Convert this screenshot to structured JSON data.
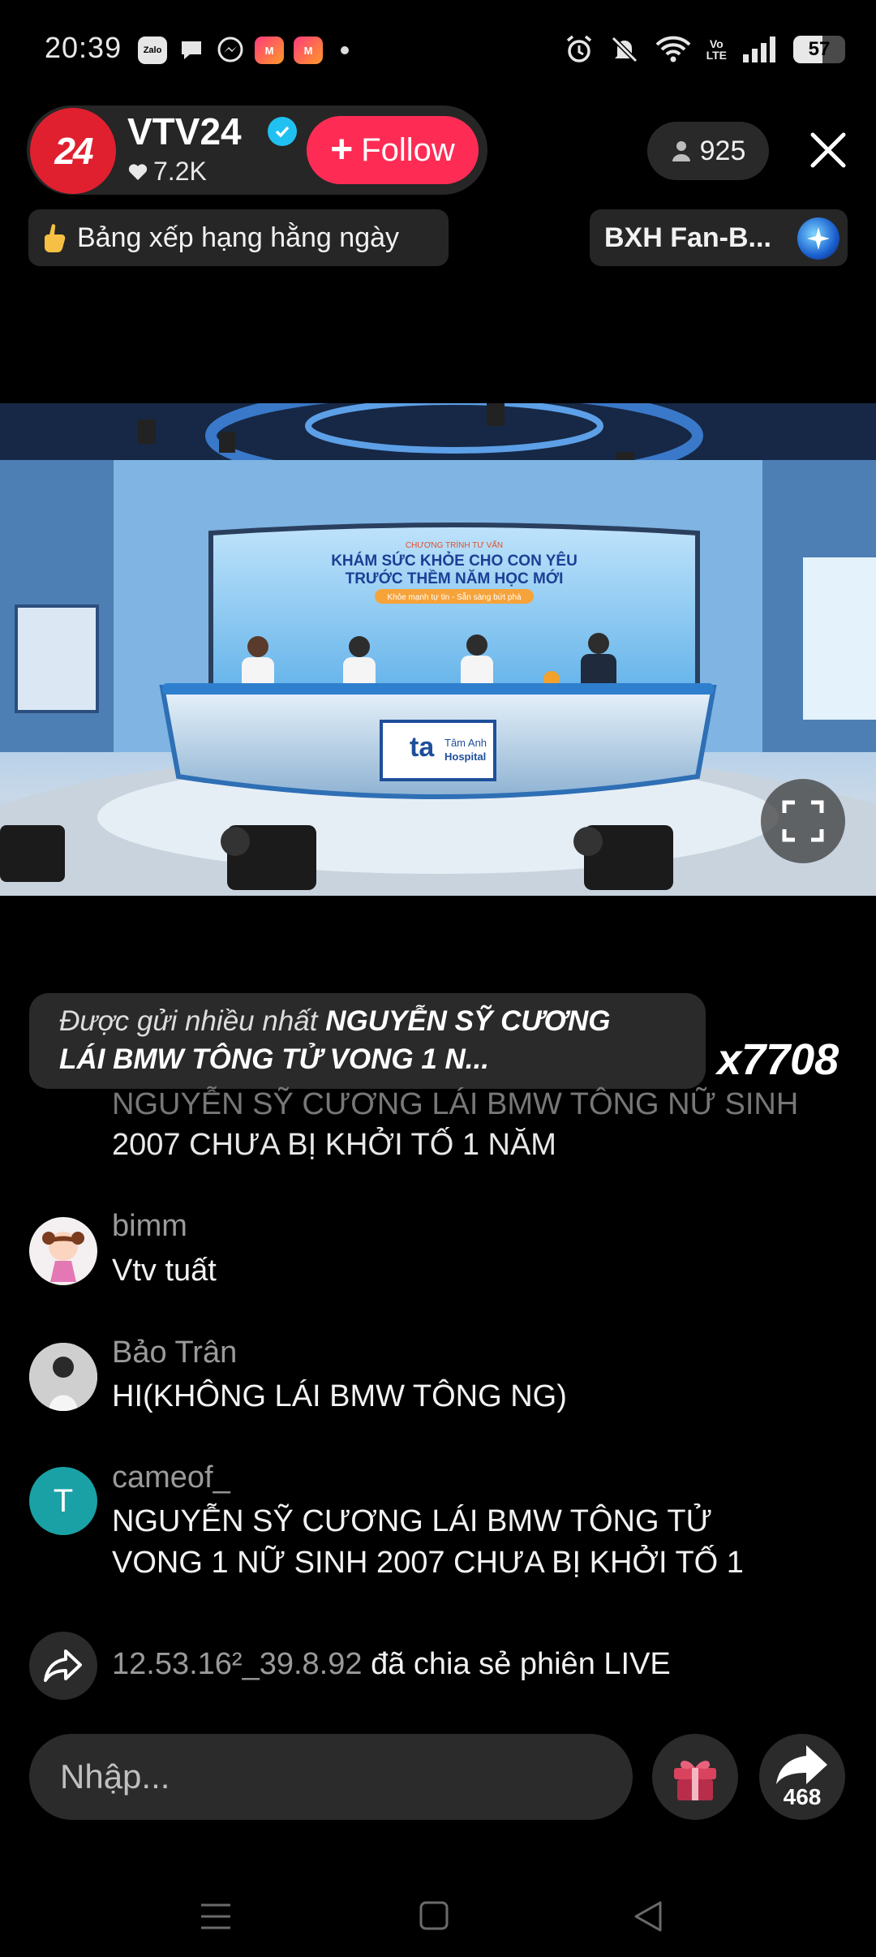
{
  "status_bar": {
    "time": "20:39",
    "notification_icons": [
      "zalo-icon",
      "chat-bubble-icon",
      "messenger-icon",
      "app-m-icon",
      "app-m-icon"
    ],
    "zalo_label": "Zalo",
    "volte_label_top": "Vo",
    "volte_label_bottom": "LTE",
    "battery_level": "57"
  },
  "host": {
    "avatar_text": "24",
    "name": "VTV24",
    "likes": "7.2K",
    "follow_label": "Follow",
    "brand_color": "#e0202f"
  },
  "viewers": {
    "count": "925"
  },
  "ranking": {
    "daily_label": "Bảng xếp hạng hằng ngày",
    "fan_label": "BXH Fan-B..."
  },
  "video": {
    "banner_small": "CHƯƠNG TRÌNH TƯ VẤN",
    "banner_line1": "KHÁM SỨC KHỎE CHO CON YÊU",
    "banner_line2": "TRƯỚC THỀM NĂM HỌC MỚI",
    "banner_tag": "Khỏe mạnh tự tin - Sẵn sàng bứt phá",
    "desk_logo_mark": "ta",
    "desk_logo_line1": "Tâm Anh",
    "desk_logo_line2": "Hospital"
  },
  "top_gift": {
    "prefix": "Được gửi nhiều nhất",
    "text_line1": "NGUYỄN SỸ CƯƠNG",
    "text_line2": "LÁI BMW TÔNG TỬ VONG 1 N...",
    "count": "x7708"
  },
  "comments": {
    "faded_line1": "NGUYỄN SỸ CƯƠNG LÁI BMW TÔNG NỮ SINH",
    "faded_line2": "2007 CHƯA BỊ KHỞI TỐ 1 NĂM",
    "items": [
      {
        "user": "bimm",
        "text": "Vtv tuất"
      },
      {
        "user": "Bảo Trân",
        "text": "HI(KHÔNG LÁI BMW TÔNG NG)"
      },
      {
        "user": "cameof_",
        "avatar_letter": "T",
        "text_line1": "NGUYỄN SỸ CƯƠNG LÁI BMW TÔNG TỬ",
        "text_line2": "VONG 1 NỮ SINH 2007 CHƯA BỊ KHỞI TỐ 1"
      }
    ],
    "share_event": {
      "user": "12.53.16²_39.8.92",
      "text": "đã chia sẻ phiên LIVE"
    }
  },
  "bottom_bar": {
    "input_placeholder": "Nhập...",
    "share_count": "468"
  }
}
